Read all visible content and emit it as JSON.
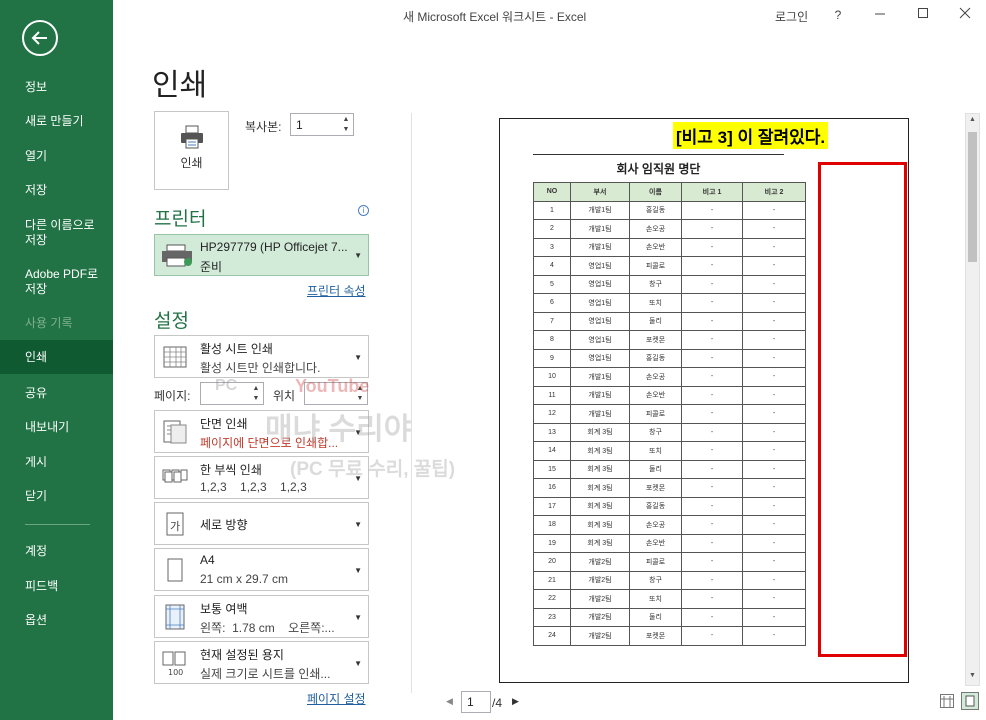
{
  "window": {
    "title": "새 Microsoft Excel 워크시트  -  Excel",
    "login": "로그인",
    "help": "?"
  },
  "sidebar": {
    "items": [
      {
        "label": "정보"
      },
      {
        "label": "새로 만들기"
      },
      {
        "label": "열기"
      },
      {
        "label": "저장"
      },
      {
        "label": "다른 이름으로 저장"
      },
      {
        "label": "Adobe PDF로 저장"
      },
      {
        "label": "사용 기록"
      },
      {
        "label": "인쇄"
      },
      {
        "label": "공유"
      },
      {
        "label": "내보내기"
      },
      {
        "label": "게시"
      },
      {
        "label": "닫기"
      },
      {
        "label": "계정"
      },
      {
        "label": "피드백"
      },
      {
        "label": "옵션"
      }
    ]
  },
  "print": {
    "heading": "인쇄",
    "button_label": "인쇄",
    "copies_label": "복사본:",
    "copies_value": "1"
  },
  "printer": {
    "heading": "프린터",
    "name": "HP297779 (HP Officejet 7...",
    "status": "준비",
    "properties_link": "프린터 속성"
  },
  "settings": {
    "heading": "설정",
    "scope": {
      "title": "활성 시트 인쇄",
      "sub": "활성 시트만 인쇄합니다."
    },
    "pages_label": "페이지:",
    "to_label": "위치",
    "sides": {
      "title": "단면 인쇄",
      "sub": "페이지에 단면으로 인쇄합..."
    },
    "collate": {
      "title": "한 부씩 인쇄",
      "sub": "1,2,3    1,2,3    1,2,3"
    },
    "orientation": {
      "title": "세로 방향",
      "sub": ""
    },
    "paper": {
      "title": "A4",
      "sub": "21 cm x 29.7 cm"
    },
    "margins": {
      "title": "보통 여백",
      "sub": "왼쪽:  1.78 cm    오른쪽:..."
    },
    "scaling": {
      "title": "현재 설정된 용지",
      "sub": "실제 크기로 시트를 인쇄..."
    },
    "page_setup_link": "페이지 설정"
  },
  "preview": {
    "sheet_title": "회사 임직원 명단",
    "headers": [
      "NO",
      "부서",
      "이름",
      "비고 1",
      "비고 2"
    ],
    "rows": [
      [
        "1",
        "개발1팀",
        "홍길동",
        "-",
        "-"
      ],
      [
        "2",
        "개발1팀",
        "손오공",
        "-",
        "-"
      ],
      [
        "3",
        "개발1팀",
        "손오반",
        "-",
        "-"
      ],
      [
        "4",
        "영업1팀",
        "피콜로",
        "-",
        "-"
      ],
      [
        "5",
        "영업1팀",
        "창구",
        "-",
        "-"
      ],
      [
        "6",
        "영업1팀",
        "또치",
        "-",
        "-"
      ],
      [
        "7",
        "영업1팀",
        "둘리",
        "-",
        "-"
      ],
      [
        "8",
        "영업1팀",
        "포켓몬",
        "-",
        "-"
      ],
      [
        "9",
        "영업1팀",
        "홍길동",
        "-",
        "-"
      ],
      [
        "10",
        "개발1팀",
        "손오공",
        "-",
        "-"
      ],
      [
        "11",
        "개발1팀",
        "손오반",
        "-",
        "-"
      ],
      [
        "12",
        "개발1팀",
        "피콜로",
        "-",
        "-"
      ],
      [
        "13",
        "회계 3팀",
        "창구",
        "-",
        "-"
      ],
      [
        "14",
        "회계 3팀",
        "또치",
        "-",
        "-"
      ],
      [
        "15",
        "회계 3팀",
        "둘리",
        "-",
        "-"
      ],
      [
        "16",
        "회계 3팀",
        "포켓몬",
        "-",
        "-"
      ],
      [
        "17",
        "회계 3팀",
        "홍길동",
        "-",
        "-"
      ],
      [
        "18",
        "회계 3팀",
        "손오공",
        "-",
        "-"
      ],
      [
        "19",
        "회계 3팀",
        "손오반",
        "-",
        "-"
      ],
      [
        "20",
        "개발2팀",
        "피콜로",
        "-",
        "-"
      ],
      [
        "21",
        "개발2팀",
        "창구",
        "-",
        "-"
      ],
      [
        "22",
        "개발2팀",
        "또치",
        "-",
        "-"
      ],
      [
        "23",
        "개발2팀",
        "둘리",
        "-",
        "-"
      ],
      [
        "24",
        "개발2팀",
        "포켓몬",
        "-",
        "-"
      ]
    ],
    "annotation": "[비고 3] 이 잘려있다."
  },
  "watermark": {
    "pc": "PC",
    "youtube": "YouTube",
    "main": "매냐 수리야",
    "sub": "(PC 무료 수리, 꿀팁)"
  },
  "pagenav": {
    "current": "1",
    "total": "/4"
  },
  "colors": {
    "accent": "#217346",
    "annotation_border": "#e00000",
    "annotation_bg": "#ffff00"
  }
}
